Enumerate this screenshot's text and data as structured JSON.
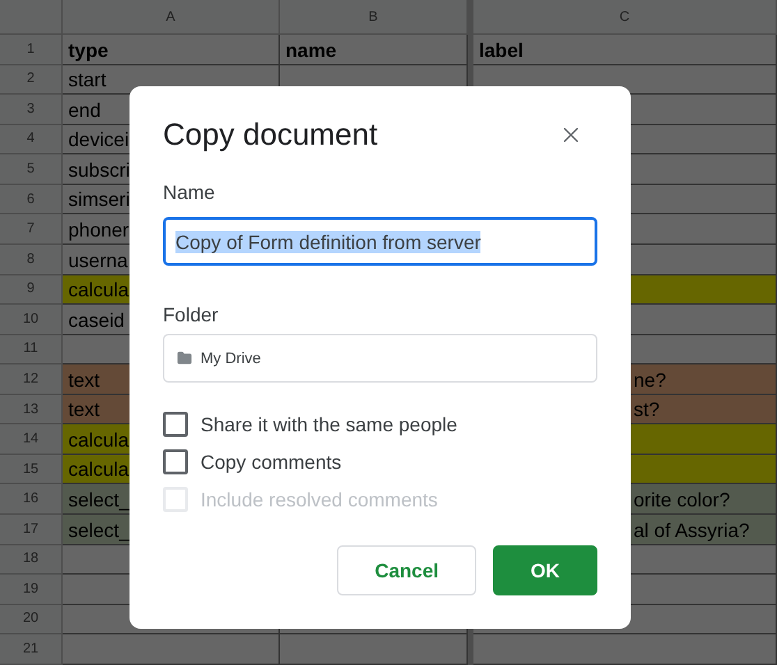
{
  "sheet": {
    "columns": [
      "A",
      "B",
      "C"
    ],
    "rows": [
      {
        "number": "1",
        "kind": "header",
        "cells": [
          "type",
          "name",
          "label"
        ]
      },
      {
        "number": "2",
        "kind": "data",
        "cells": [
          "start",
          "",
          ""
        ]
      },
      {
        "number": "3",
        "kind": "data",
        "cells": [
          "end",
          "",
          ""
        ]
      },
      {
        "number": "4",
        "kind": "data",
        "cells": [
          "devicei",
          "",
          ""
        ]
      },
      {
        "number": "5",
        "kind": "data",
        "cells": [
          "subscri",
          "",
          ""
        ]
      },
      {
        "number": "6",
        "kind": "data",
        "cells": [
          "simseri",
          "",
          ""
        ]
      },
      {
        "number": "7",
        "kind": "data",
        "cells": [
          "phoner",
          "",
          ""
        ]
      },
      {
        "number": "8",
        "kind": "data",
        "cells": [
          "userna",
          "",
          ""
        ]
      },
      {
        "number": "9",
        "kind": "data",
        "color": "#666600",
        "cells": [
          "calcula",
          "",
          ""
        ]
      },
      {
        "number": "10",
        "kind": "data",
        "cells": [
          "caseid",
          "",
          ""
        ]
      },
      {
        "number": "11",
        "kind": "data",
        "cells": [
          "",
          "",
          ""
        ]
      },
      {
        "number": "12",
        "kind": "data",
        "color": "#644a37",
        "cells": [
          "text",
          "",
          "ne?"
        ]
      },
      {
        "number": "13",
        "kind": "data",
        "color": "#644a37",
        "cells": [
          "text",
          "",
          "st?"
        ]
      },
      {
        "number": "14",
        "kind": "data",
        "color": "#666600",
        "cells": [
          "calcula",
          "",
          ""
        ]
      },
      {
        "number": "15",
        "kind": "data",
        "color": "#666600",
        "cells": [
          "calcula",
          "",
          ""
        ]
      },
      {
        "number": "16",
        "kind": "data",
        "color": "#535a4e",
        "cells": [
          "select_",
          "",
          "orite color?"
        ]
      },
      {
        "number": "17",
        "kind": "data",
        "color": "#535a4e",
        "cells": [
          "select_",
          "",
          "al of Assyria?"
        ]
      },
      {
        "number": "18",
        "kind": "data",
        "cells": [
          "",
          "",
          ""
        ]
      },
      {
        "number": "19",
        "kind": "data",
        "cells": [
          "",
          "",
          ""
        ]
      },
      {
        "number": "20",
        "kind": "data",
        "cells": [
          "",
          "",
          ""
        ]
      },
      {
        "number": "21",
        "kind": "data",
        "cells": [
          "",
          "",
          ""
        ]
      }
    ]
  },
  "dialog": {
    "title": "Copy document",
    "name_label": "Name",
    "name_value": "Copy of Form definition from server",
    "name_text_selected": true,
    "folder_label": "Folder",
    "folder_value": "My Drive",
    "options": [
      {
        "label": "Share it with the same people",
        "checked": false,
        "disabled": false
      },
      {
        "label": "Copy comments",
        "checked": false,
        "disabled": false
      },
      {
        "label": "Include resolved comments",
        "checked": false,
        "disabled": true
      }
    ],
    "buttons": [
      {
        "label": "Cancel",
        "kind": "secondary"
      },
      {
        "label": "OK",
        "kind": "primary"
      }
    ]
  }
}
